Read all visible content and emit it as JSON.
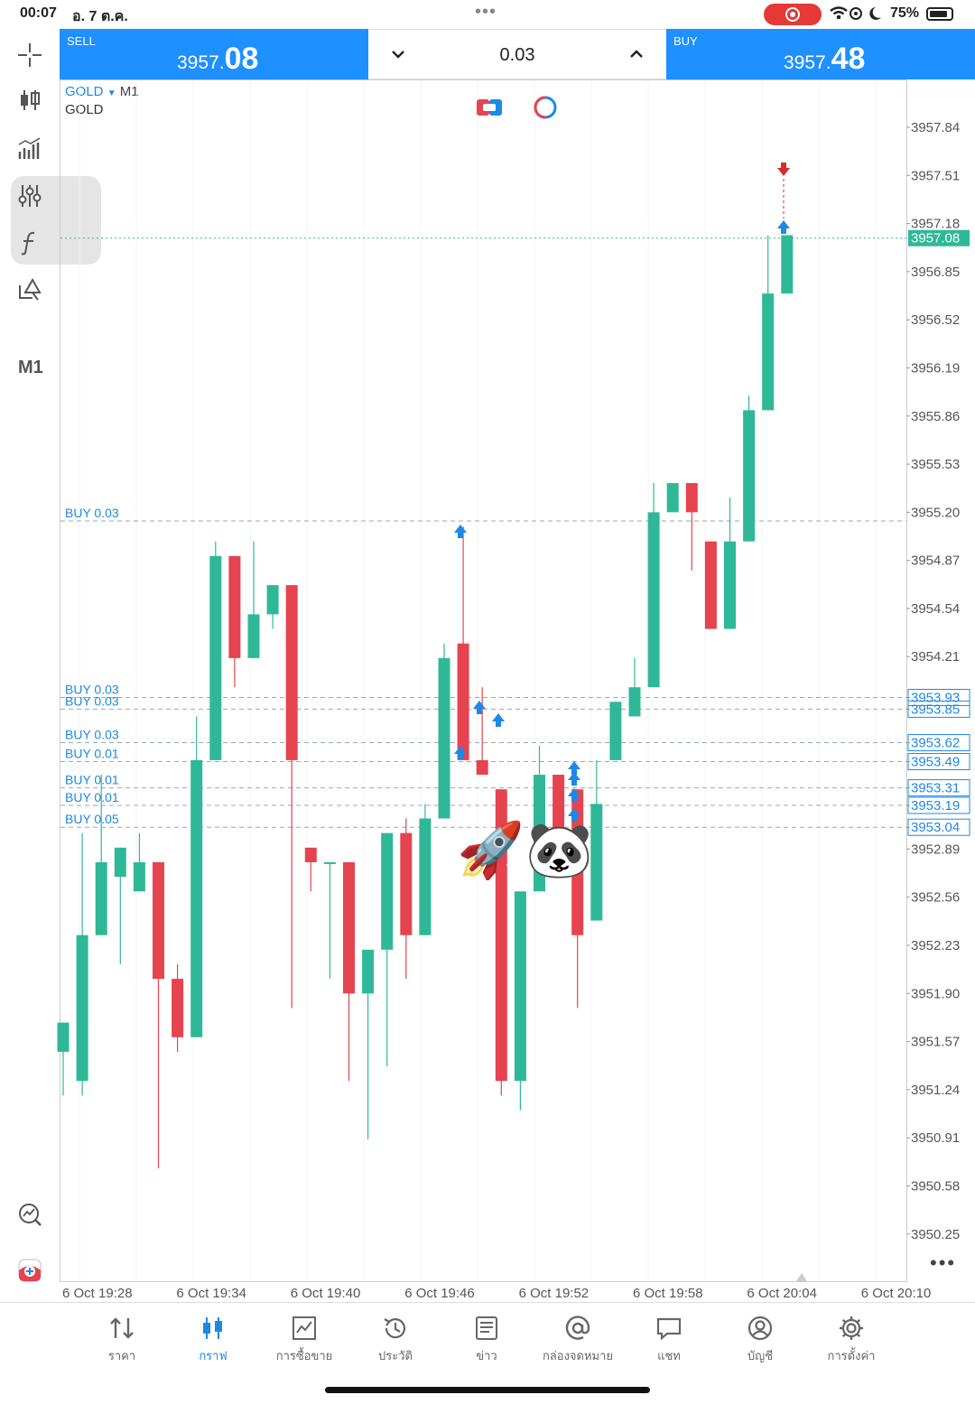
{
  "status_bar": {
    "time": "00:07",
    "date": "อ. 7 ต.ค.",
    "battery": "75%"
  },
  "trade": {
    "sell_label": "SELL",
    "sell_small": "3957.",
    "sell_big": "08",
    "buy_label": "BUY",
    "buy_small": "3957.",
    "buy_big": "48",
    "lot": "0.03"
  },
  "chart": {
    "symbol": "GOLD",
    "timeframe": "M1",
    "description": "GOLD",
    "toolbar_timeframe": "M1",
    "price_ticks": [
      "3957.84",
      "3957.51",
      "3957.18",
      "3956.85",
      "3956.52",
      "3956.19",
      "3955.86",
      "3955.53",
      "3955.20",
      "3954.87",
      "3954.54",
      "3954.21",
      "3953.93",
      "3953.85",
      "3953.62",
      "3953.49",
      "3953.31",
      "3953.19",
      "3953.04",
      "3952.89",
      "3952.56",
      "3952.23",
      "3951.90",
      "3951.57",
      "3951.24",
      "3950.91",
      "3950.58",
      "3950.25"
    ],
    "time_ticks": [
      "6 Oct 19:28",
      "6 Oct 19:34",
      "6 Oct 19:40",
      "6 Oct 19:46",
      "6 Oct 19:52",
      "6 Oct 19:58",
      "6 Oct 20:04",
      "6 Oct 20:10"
    ],
    "current_price": "3957.08",
    "orders": [
      {
        "label": "BUY 0.03",
        "price": "3955.14"
      },
      {
        "label": "BUY 0.03",
        "price": "3953.93"
      },
      {
        "label": "BUY 0.03",
        "price": "3953.85"
      },
      {
        "label": "BUY 0.03",
        "price": "3953.62"
      },
      {
        "label": "BUY 0.01",
        "price": "3953.49"
      },
      {
        "label": "BUY 0.01",
        "price": "3953.31"
      },
      {
        "label": "BUY 0.01",
        "price": "3953.19"
      },
      {
        "label": "BUY 0.05",
        "price": "3953.04"
      }
    ],
    "colors": {
      "bull": "#2fb897",
      "bear": "#e5434f",
      "accent": "#1e88e5",
      "order_line": "#9aa7b3"
    },
    "candles": [
      [
        3951.5,
        3951.7,
        3951.3,
        3951.2
      ],
      [
        3951.3,
        3952.3,
        3951.2,
        3953.0
      ],
      [
        3952.3,
        3952.8,
        3952.3,
        3953.4
      ],
      [
        3952.7,
        3952.9,
        3952.6,
        3952.1
      ],
      [
        3952.6,
        3952.8,
        3952.6,
        3953.0
      ],
      [
        3952.8,
        3952.0,
        3952.8,
        3950.7
      ],
      [
        3952.0,
        3951.6,
        3952.1,
        3951.5
      ],
      [
        3951.6,
        3953.5,
        3951.6,
        3953.8
      ],
      [
        3953.5,
        3954.9,
        3953.5,
        3955.0
      ],
      [
        3954.9,
        3954.2,
        3954.9,
        3954.0
      ],
      [
        3954.2,
        3954.5,
        3954.2,
        3955.0
      ],
      [
        3954.5,
        3954.7,
        3954.4,
        3954.4
      ],
      [
        3954.7,
        3953.5,
        3954.7,
        3951.8
      ],
      [
        3952.9,
        3952.8,
        3952.9,
        3952.6
      ],
      [
        3952.8,
        3952.8,
        3952.8,
        3952.0
      ],
      [
        3952.8,
        3951.9,
        3952.8,
        3951.3
      ],
      [
        3951.9,
        3952.2,
        3951.9,
        3950.9
      ],
      [
        3952.2,
        3953.0,
        3952.2,
        3951.4
      ],
      [
        3953.0,
        3952.3,
        3953.1,
        3952.0
      ],
      [
        3952.3,
        3953.1,
        3952.3,
        3953.2
      ],
      [
        3953.1,
        3954.2,
        3953.1,
        3954.3
      ],
      [
        3954.3,
        3953.5,
        3954.3,
        3955.1
      ],
      [
        3953.5,
        3953.4,
        3953.5,
        3954.0
      ],
      [
        3953.3,
        3951.3,
        3953.3,
        3951.2
      ],
      [
        3951.3,
        3952.6,
        3951.2,
        3951.1
      ],
      [
        3952.6,
        3953.4,
        3952.6,
        3953.6
      ],
      [
        3953.4,
        3952.8,
        3953.4,
        3953.0
      ],
      [
        3953.3,
        3952.3,
        3953.3,
        3951.8
      ],
      [
        3952.4,
        3953.2,
        3952.4,
        3953.5
      ],
      [
        3953.5,
        3953.9,
        3953.5,
        3953.7
      ],
      [
        3953.8,
        3954.0,
        3953.8,
        3954.2
      ],
      [
        3954.0,
        3955.2,
        3954.0,
        3955.4
      ],
      [
        3955.2,
        3955.4,
        3955.2,
        3955.4
      ],
      [
        3955.4,
        3955.2,
        3955.4,
        3954.8
      ],
      [
        3955.0,
        3954.4,
        3955.0,
        3954.4
      ],
      [
        3954.4,
        3955.0,
        3954.4,
        3955.3
      ],
      [
        3955.0,
        3955.9,
        3955.0,
        3956.0
      ],
      [
        3955.9,
        3956.7,
        3955.9,
        3957.1
      ],
      [
        3956.7,
        3957.1,
        3956.7,
        3957.1
      ]
    ]
  },
  "nav": [
    {
      "label": "ราคา",
      "icon": "quotes-icon"
    },
    {
      "label": "กราฟ",
      "icon": "chart-icon",
      "active": true
    },
    {
      "label": "การซื้อขาย",
      "icon": "trade-icon"
    },
    {
      "label": "ประวัติ",
      "icon": "history-icon"
    },
    {
      "label": "ข่าว",
      "icon": "news-icon"
    },
    {
      "label": "กล่องจดหมาย",
      "icon": "mailbox-icon"
    },
    {
      "label": "แชท",
      "icon": "chat-icon"
    },
    {
      "label": "บัญชี",
      "icon": "account-icon"
    },
    {
      "label": "การตั้งค่า",
      "icon": "settings-icon"
    }
  ]
}
